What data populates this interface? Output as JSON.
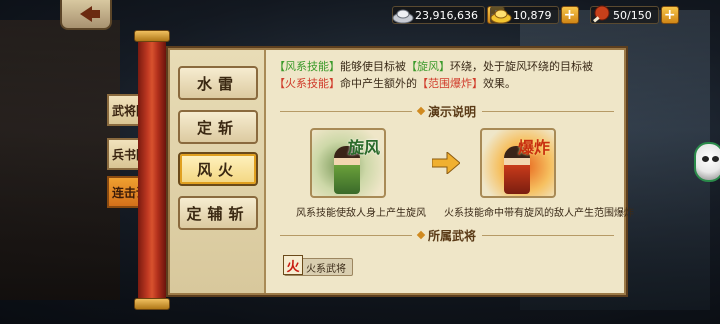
{
  "resources": {
    "silver": "23,916,636",
    "gold": "10,879",
    "stamina": "50/150"
  },
  "side_tabs": [
    "武将图鉴",
    "兵书图鉴",
    "连击说明"
  ],
  "active_side_tab": 2,
  "sub_tabs": [
    "水雷",
    "定斩",
    "风火",
    "定辅斩"
  ],
  "active_sub_tab": 2,
  "description": {
    "part1": "【风系技能】",
    "part2": "能够使目标被",
    "part3": "【旋风】",
    "part4": "环绕，处于旋风环绕的目标被",
    "part5": "【火系技能】",
    "part6": "命中产生额外的",
    "part7": "【范围爆炸】",
    "part8": "效果。"
  },
  "demo_title": "演示说明",
  "demo": {
    "left_fx": "旋风",
    "right_fx": "爆炸",
    "left_caption": "风系技能使敌人身上产生旋风",
    "right_caption": "火系技能命中带有旋风的敌人产生范围爆炸"
  },
  "generals_title": "所属武将",
  "general_badge": {
    "icon": "火",
    "label": "火系武将"
  },
  "colors": {
    "accent_orange": "#d4701a",
    "skill_green": "#3a9a2a",
    "skill_red": "#d03a2a"
  }
}
